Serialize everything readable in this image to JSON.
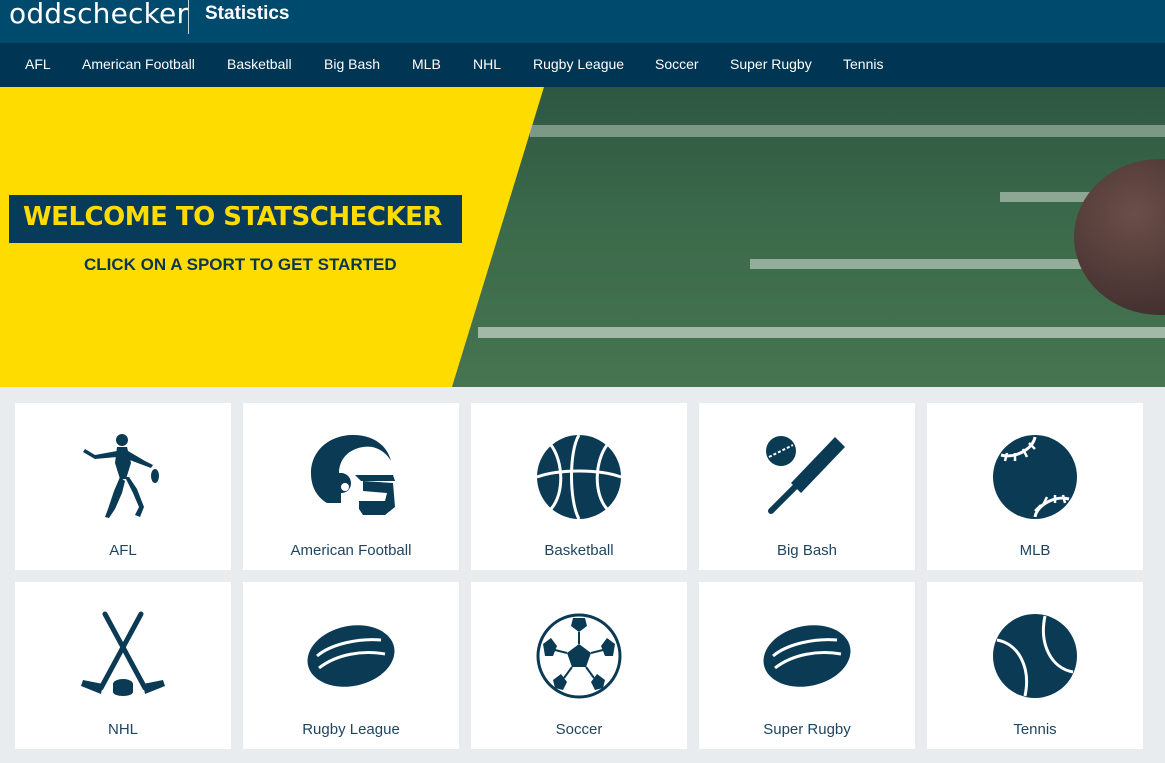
{
  "header": {
    "logo": "oddschecker",
    "section": "Statistics"
  },
  "nav": {
    "items": [
      {
        "label": "AFL",
        "key": "afl"
      },
      {
        "label": "American Football",
        "key": "american-football"
      },
      {
        "label": "Basketball",
        "key": "basketball"
      },
      {
        "label": "Big Bash",
        "key": "big-bash"
      },
      {
        "label": "MLB",
        "key": "mlb"
      },
      {
        "label": "NHL",
        "key": "nhl"
      },
      {
        "label": "Rugby League",
        "key": "rugby-league"
      },
      {
        "label": "Soccer",
        "key": "soccer"
      },
      {
        "label": "Super Rugby",
        "key": "super-rugby"
      },
      {
        "label": "Tennis",
        "key": "tennis"
      }
    ]
  },
  "hero": {
    "title": "WELCOME TO STATSCHECKER",
    "subtitle": "CLICK ON A SPORT TO GET STARTED"
  },
  "sports": [
    {
      "label": "AFL",
      "icon": "afl-player-icon"
    },
    {
      "label": "American Football",
      "icon": "football-helmet-icon"
    },
    {
      "label": "Basketball",
      "icon": "basketball-icon"
    },
    {
      "label": "Big Bash",
      "icon": "cricket-bat-ball-icon"
    },
    {
      "label": "MLB",
      "icon": "baseball-icon"
    },
    {
      "label": "NHL",
      "icon": "hockey-sticks-icon"
    },
    {
      "label": "Rugby League",
      "icon": "rugby-ball-icon"
    },
    {
      "label": "Soccer",
      "icon": "soccer-ball-icon"
    },
    {
      "label": "Super Rugby",
      "icon": "rugby-ball-icon"
    },
    {
      "label": "Tennis",
      "icon": "tennis-ball-icon"
    }
  ],
  "colors": {
    "header_bg": "#004a6e",
    "nav_bg": "#003553",
    "accent_yellow": "#ffdc00",
    "icon_navy": "#0b3a55",
    "page_bg": "#e8ecef"
  }
}
